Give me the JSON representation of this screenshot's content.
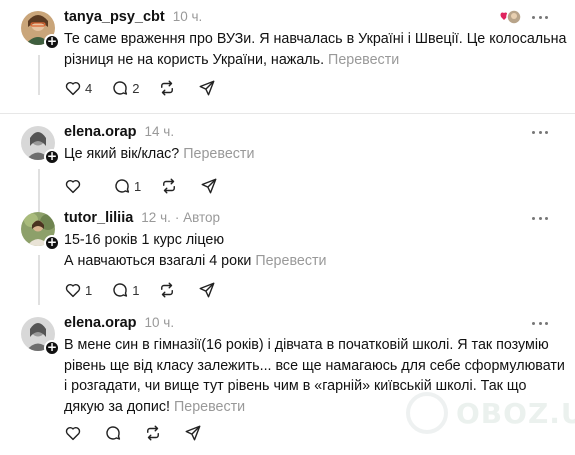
{
  "posts": [
    {
      "username": "tanya_psy_cbt",
      "time": "10 ч.",
      "lines": [
        "Те саме враження про ВУЗи. Я навчалась в Україні і Швеції. Це колосальна",
        "різниця не на користь України, нажаль."
      ],
      "translate": "Перевести",
      "likes": "4",
      "replies": "2"
    },
    {
      "username": "elena.orap",
      "time": "14 ч.",
      "lines": [
        "Це який вік/клас?"
      ],
      "translate": "Перевести",
      "likes": "",
      "replies": "1"
    },
    {
      "username": "tutor_liliia",
      "time": "12 ч.",
      "author_badge": "· Автор",
      "lines": [
        "15-16 років 1 курс ліцею",
        "А навчаються взагалі 4 роки"
      ],
      "translate": "Перевести",
      "likes": "1",
      "replies": "1"
    },
    {
      "username": "elena.orap",
      "time": "10 ч.",
      "lines": [
        "В мене син в гімназії(16 років) і дівчата в початковій школі. Я так позумію",
        "рівень ще від класу залежить... все ще намагаюсь для себе сформулювати",
        "і розгадати, чи вище тут рівень чим в «гарній» київській школі. Так що",
        "дякую за допис!"
      ],
      "translate": "Перевести",
      "likes": "",
      "replies": ""
    }
  ],
  "watermark": "OBOZ.UA",
  "colors": {
    "text": "#111111",
    "muted": "#999999",
    "divider": "#e7e7e7",
    "reaction_heart": "#e0245e"
  }
}
